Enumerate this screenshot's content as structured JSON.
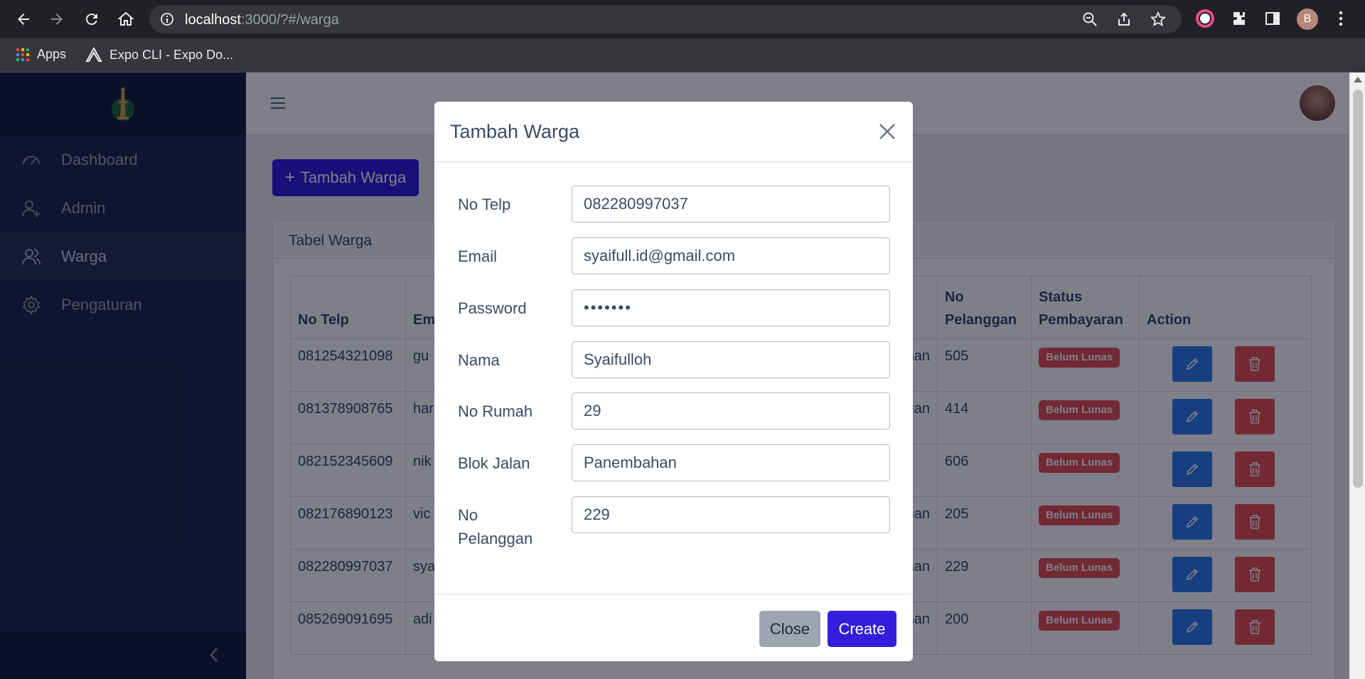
{
  "browser": {
    "url_host": "localhost",
    "url_path": ":3000/?#/warga",
    "profile_initial": "B",
    "bookmarks": [
      {
        "label": "Apps"
      },
      {
        "label": "Expo CLI - Expo Do..."
      }
    ]
  },
  "sidebar": {
    "items": [
      {
        "label": "Dashboard"
      },
      {
        "label": "Admin"
      },
      {
        "label": "Warga"
      },
      {
        "label": "Pengaturan"
      }
    ]
  },
  "page": {
    "add_button": "Tambah Warga",
    "card_title": "Tabel Warga",
    "columns": [
      "No Telp",
      "Em",
      "",
      "",
      "",
      "",
      "No Pelanggan",
      "Status Pembayaran",
      "Action"
    ],
    "rows": [
      {
        "telp": "081254321098",
        "email": "gu",
        "blok": "man",
        "pel": "505",
        "status": "Belum Lunas"
      },
      {
        "telp": "081378908765",
        "email": "har",
        "blok": "gan",
        "pel": "414",
        "status": "Belum Lunas"
      },
      {
        "telp": "082152345609",
        "email": "nik",
        "blok": "",
        "pel": "606",
        "status": "Belum Lunas"
      },
      {
        "telp": "082176890123",
        "email": "vic",
        "blok": "han",
        "pel": "205",
        "status": "Belum Lunas"
      },
      {
        "telp": "082280997037",
        "email": "sya",
        "blok": "han",
        "pel": "229",
        "status": "Belum Lunas"
      },
      {
        "telp": "085269091695",
        "email": "adi",
        "blok": "han",
        "pel": "200",
        "status": "Belum Lunas"
      }
    ]
  },
  "modal": {
    "title": "Tambah Warga",
    "fields": [
      {
        "label": "No Telp",
        "value": "082280997037"
      },
      {
        "label": "Email",
        "value": "syaifull.id@gmail.com"
      },
      {
        "label": "Password",
        "value": "•••••••"
      },
      {
        "label": "Nama",
        "value": "Syaifulloh"
      },
      {
        "label": "No Rumah",
        "value": "29"
      },
      {
        "label": "Blok Jalan",
        "value": "Panembahan"
      },
      {
        "label": "No Pelanggan",
        "value": "229"
      }
    ],
    "close_label": "Close",
    "create_label": "Create"
  },
  "colors": {
    "primary": "#321fdb",
    "danger": "#e55353",
    "info": "#2f7ee9",
    "sidebar": "#1e2b4a"
  }
}
